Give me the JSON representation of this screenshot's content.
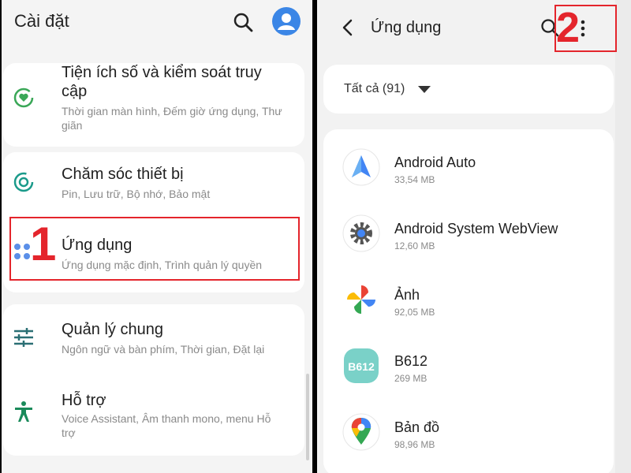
{
  "left": {
    "title": "Cài đặt",
    "items": [
      {
        "title": "Tiện ích số và kiểm soát truy cập",
        "subtitle": "Thời gian màn hình, Đếm giờ ứng dụng, Thư giãn"
      },
      {
        "title": "Chăm sóc thiết bị",
        "subtitle": "Pin, Lưu trữ, Bộ nhớ, Bảo mật"
      },
      {
        "title": "Ứng dụng",
        "subtitle": "Ứng dụng mặc định, Trình quản lý quyền"
      },
      {
        "title": "Quản lý chung",
        "subtitle": "Ngôn ngữ và bàn phím, Thời gian, Đặt lại"
      },
      {
        "title": "Hỗ trợ",
        "subtitle": "Voice Assistant, Âm thanh mono, menu Hỗ trợ"
      }
    ],
    "step_label": "1"
  },
  "right": {
    "title": "Ứng dụng",
    "step_label": "2",
    "filter_label": "Tất cả (91)",
    "apps": [
      {
        "name": "Android Auto",
        "size": "33,54 MB"
      },
      {
        "name": "Android System WebView",
        "size": "12,60 MB"
      },
      {
        "name": "Ảnh",
        "size": "92,05 MB"
      },
      {
        "name": "B612",
        "size": "269 MB"
      },
      {
        "name": "Bản đồ",
        "size": "98,96 MB"
      }
    ]
  },
  "colors": {
    "highlight": "#e4252c",
    "accent_blue": "#3b86e6",
    "icon_teal": "#1a9a8a",
    "icon_green": "#3aa757"
  }
}
